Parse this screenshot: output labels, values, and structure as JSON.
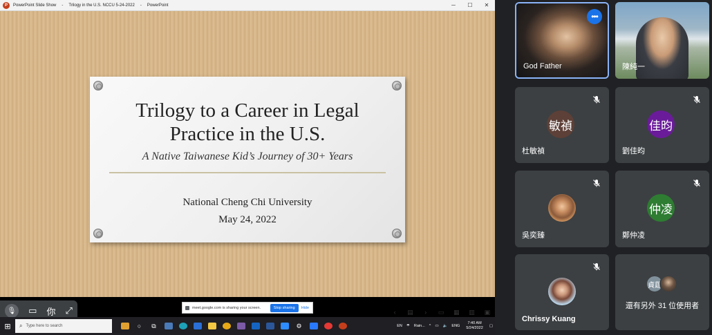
{
  "window": {
    "app_label": "PowerPoint Slide Show",
    "doc_title": "Trilogy in the U.S. NCCU 5-24-2022",
    "app_name": "PowerPoint",
    "minimize": "─",
    "maximize": "☐",
    "close": "✕"
  },
  "slide": {
    "title_line1": "Trilogy to a Career in Legal",
    "title_line2": "Practice in the U.S.",
    "subtitle": "A Native Taiwanese Kid’s Journey of  30+ Years",
    "org": "National Cheng Chi University",
    "date": "May 24, 2022"
  },
  "meet_float": {
    "mic_icon": "🎙",
    "cam_icon": "▭",
    "ime_label": "你",
    "expand_icon": "⤢"
  },
  "share_banner": {
    "text": "meet.google.com is sharing your screen.",
    "stop_label": "Stop sharing",
    "hide_label": "Hide"
  },
  "taskbar": {
    "start_icon": "⊞",
    "search_placeholder": "Type here to search",
    "ime": "EN",
    "weather": "Rain...",
    "lang": "ENG",
    "time": "7:40 AM",
    "date": "5/24/2022"
  },
  "participants": [
    {
      "name": "God Father",
      "type": "video",
      "muted": false
    },
    {
      "name": "陳純一",
      "type": "video",
      "muted": false
    },
    {
      "name": "杜敏禎",
      "type": "letter",
      "initials": "敏禎",
      "color": "#5d4037",
      "muted": true
    },
    {
      "name": "劉佳昀",
      "type": "letter",
      "initials": "佳昀",
      "color": "#6a1b9a",
      "muted": true
    },
    {
      "name": "吳奕臻",
      "type": "photo",
      "muted": true
    },
    {
      "name": "鄭仲凌",
      "type": "letter",
      "initials": "仲凌",
      "color": "#2e7d32",
      "muted": true
    },
    {
      "name": "Chrissy Kuang",
      "type": "photo",
      "muted": true
    }
  ],
  "others": {
    "text": "還有另外 31 位使用者",
    "avatar_initials": "貞莛"
  },
  "colors": {
    "meet_bg": "#202124",
    "tile_bg": "#3c4043",
    "active_border": "#8ab4f8",
    "accent_blue": "#1a73e8"
  }
}
